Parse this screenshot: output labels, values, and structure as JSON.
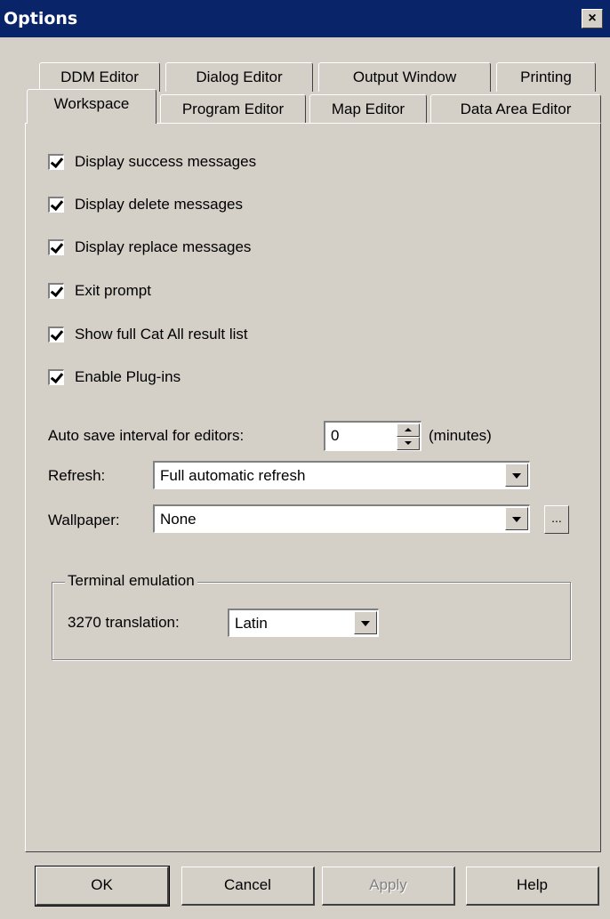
{
  "window": {
    "title": "Options",
    "close_glyph": "×"
  },
  "tabs_back": [
    "DDM Editor",
    "Dialog Editor",
    "Output Window",
    "Printing"
  ],
  "tabs_front": [
    "Workspace",
    "Program Editor",
    "Map Editor",
    "Data Area Editor"
  ],
  "active_tab": "Workspace",
  "checkboxes": [
    {
      "label": "Display success messages",
      "checked": true
    },
    {
      "label": "Display delete messages",
      "checked": true
    },
    {
      "label": "Display replace messages",
      "checked": true
    },
    {
      "label": "Exit prompt",
      "checked": true
    },
    {
      "label": "Show full Cat All result list",
      "checked": true
    },
    {
      "label": "Enable Plug-ins",
      "checked": true
    }
  ],
  "autosave": {
    "label": "Auto save interval for editors:",
    "value": "0",
    "unit": "(minutes)"
  },
  "refresh": {
    "label": "Refresh:",
    "value": "Full automatic refresh"
  },
  "wallpaper": {
    "label": "Wallpaper:",
    "value": "None",
    "browse": "..."
  },
  "terminal": {
    "legend": "Terminal emulation",
    "label": "3270 translation:",
    "value": "Latin"
  },
  "buttons": {
    "ok": "OK",
    "cancel": "Cancel",
    "apply": "Apply",
    "help": "Help"
  },
  "icons": [
    "close-icon",
    "checkbox-checked-icon",
    "spin-up-icon",
    "spin-down-icon",
    "dropdown-arrow-icon"
  ]
}
